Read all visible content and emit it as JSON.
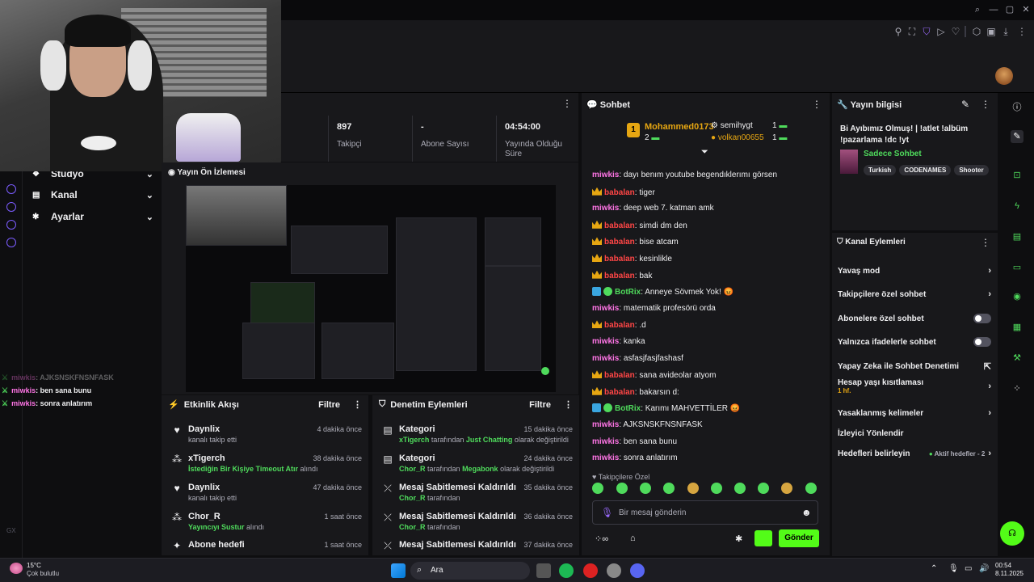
{
  "header": {
    "preview_label": "Yayın Ön İzlemesi"
  },
  "nav": {
    "items": [
      {
        "label": "Stüdyo"
      },
      {
        "label": "Kanal"
      },
      {
        "label": "Ayarlar"
      }
    ]
  },
  "side_chat": [
    {
      "user": "miwkis",
      "text": ": AJKSNSKFNSNFASK"
    },
    {
      "user": "miwkis",
      "text": ": ben sana bunu"
    },
    {
      "user": "miwkis",
      "text": ": sonra anlatırım"
    }
  ],
  "gx": "GX",
  "stats": [
    {
      "value": "897",
      "label": "Takipçi"
    },
    {
      "value": "-",
      "label": "Abone Sayısı"
    },
    {
      "value": "04:54:00",
      "label": "Yayında Olduğu Süre"
    }
  ],
  "activity": {
    "title": "Etkinlik Akışı",
    "filter": "Filtre",
    "items": [
      {
        "icon": "heart-icon",
        "name": "Daynlix",
        "sub": "kanalı takip etti",
        "sub_g": "",
        "time": "4 dakika önce"
      },
      {
        "icon": "gift-icon",
        "name": "xTigerch",
        "sub": " alındı",
        "sub_g": "İstediğin Bir Kişiye Timeout Atır",
        "time": "38 dakika önce"
      },
      {
        "icon": "heart-icon",
        "name": "Daynlix",
        "sub": "kanalı takip etti",
        "sub_g": "",
        "time": "47 dakika önce"
      },
      {
        "icon": "gift-icon",
        "name": "Chor_R",
        "sub": " alındı",
        "sub_g": "Yayıncıyı Sustur",
        "time": "1 saat önce"
      },
      {
        "icon": "star-icon",
        "name": "Abone hedefi",
        "sub": "",
        "sub_g": "",
        "time": "1 saat önce"
      }
    ]
  },
  "moderation": {
    "title": "Denetim Eylemleri",
    "filter": "Filtre",
    "items": [
      {
        "name": "Kategori",
        "who": "xTigerch",
        "mid": " tarafından ",
        "what": "Just Chatting",
        "end": " olarak değiştirildi",
        "time": "15 dakika önce"
      },
      {
        "name": "Kategori",
        "who": "Chor_R",
        "mid": " tarafından ",
        "what": "Megabonk",
        "end": " olarak değiştirildi",
        "time": "24 dakika önce"
      },
      {
        "name": "Mesaj Sabitlemesi Kaldırıldı",
        "who": "Chor_R",
        "mid": " tarafından",
        "what": "",
        "end": "",
        "time": "35 dakika önce"
      },
      {
        "name": "Mesaj Sabitlemesi Kaldırıldı",
        "who": "Chor_R",
        "mid": " tarafından",
        "what": "",
        "end": "",
        "time": "36 dakika önce"
      },
      {
        "name": "Mesaj Sabitlemesi Kaldırıldı",
        "who": "",
        "mid": "",
        "what": "",
        "end": "",
        "time": "37 dakika önce"
      }
    ]
  },
  "chat": {
    "title": "Sohbet",
    "leader1": {
      "name": "Mohammed0173",
      "count": "2"
    },
    "leader2": {
      "name": "semihygt",
      "count": "1"
    },
    "leader3": {
      "name": "volkan00655",
      "count": "1"
    },
    "messages": [
      {
        "user": "miwkis",
        "badge": "none",
        "cls": "u1",
        "text": ": dayı benım youtube begendıklerımı görsen"
      },
      {
        "user": "babalan",
        "badge": "crown",
        "cls": "u2",
        "text": ": tiger"
      },
      {
        "user": "miwkis",
        "badge": "none",
        "cls": "u1",
        "text": ": deep web 7. katman amk"
      },
      {
        "user": "babalan",
        "badge": "crown",
        "cls": "u2",
        "text": ": simdi dm den"
      },
      {
        "user": "babalan",
        "badge": "crown",
        "cls": "u2",
        "text": ": bise atcam"
      },
      {
        "user": "babalan",
        "badge": "crown",
        "cls": "u2",
        "text": ": kesinlikle"
      },
      {
        "user": "babalan",
        "badge": "crown",
        "cls": "u2",
        "text": ": bak"
      },
      {
        "user": "BotRix",
        "badge": "bot",
        "cls": "u3",
        "text": ": Anneye Sövmek Yok! 😡"
      },
      {
        "user": "miwkis",
        "badge": "none",
        "cls": "u1",
        "text": ": matematik profesörü orda"
      },
      {
        "user": "babalan",
        "badge": "crown",
        "cls": "u2",
        "text": ": .d"
      },
      {
        "user": "miwkis",
        "badge": "none",
        "cls": "u1",
        "text": ": kanka"
      },
      {
        "user": "miwkis",
        "badge": "none",
        "cls": "u1",
        "text": ": asfasjfasjfashasf"
      },
      {
        "user": "babalan",
        "badge": "crown",
        "cls": "u2",
        "text": ": sana avideolar atyom"
      },
      {
        "user": "babalan",
        "badge": "crown",
        "cls": "u2",
        "text": ": bakarsın d:"
      },
      {
        "user": "BotRix",
        "badge": "bot",
        "cls": "u3",
        "text": ": Karımı MAHVETTİLER 😡"
      },
      {
        "user": "miwkis",
        "badge": "none",
        "cls": "u1",
        "text": ": AJKSNSKFNSNFASK"
      },
      {
        "user": "miwkis",
        "badge": "none",
        "cls": "u1",
        "text": ": ben sana bunu"
      },
      {
        "user": "miwkis",
        "badge": "none",
        "cls": "u1",
        "text": ": sonra anlatırım"
      }
    ],
    "followers_only": "Takipçilere Özel",
    "input_placeholder": "Bir mesaj gönderin",
    "send_label": "Gönder"
  },
  "info": {
    "title": "Yayın bilgisi",
    "stream_title": "Bi Ayıbımız Olmuş! | !atlet !albüm !pazarlama !dc !yt",
    "category": "Sadece Sohbet",
    "tags": [
      "Turkish",
      "CODENAMES",
      "Shooter"
    ]
  },
  "actions": {
    "title": "Kanal Eylemleri",
    "items": [
      {
        "label": "Yavaş mod",
        "ctrl": "arrow",
        "sub": ""
      },
      {
        "label": "Takipçilere özel sohbet",
        "ctrl": "arrow",
        "sub": ""
      },
      {
        "label": "Abonelere özel sohbet",
        "ctrl": "toggle",
        "sub": ""
      },
      {
        "label": "Yalnızca ifadelerle sohbet",
        "ctrl": "toggle",
        "sub": ""
      },
      {
        "label": "Yapay Zeka ile Sohbet Denetimi",
        "ctrl": "ext",
        "sub": ""
      },
      {
        "label": "Hesap yaşı kısıtlaması",
        "ctrl": "arrow",
        "sub": "1 hf."
      },
      {
        "label": "Yasaklanmış kelimeler",
        "ctrl": "arrow",
        "sub": ""
      },
      {
        "label": "İzleyici Yönlendir",
        "ctrl": "none",
        "sub": ""
      },
      {
        "label": "Hedefleri belirleyin",
        "ctrl": "goal",
        "sub": "",
        "goal": "Aktif hedefler - 2"
      }
    ]
  },
  "taskbar": {
    "weather_temp": "15°C",
    "weather_desc": "Çok bulutlu",
    "search": "Ara",
    "time": "00:54",
    "date": "8.11.2025"
  }
}
